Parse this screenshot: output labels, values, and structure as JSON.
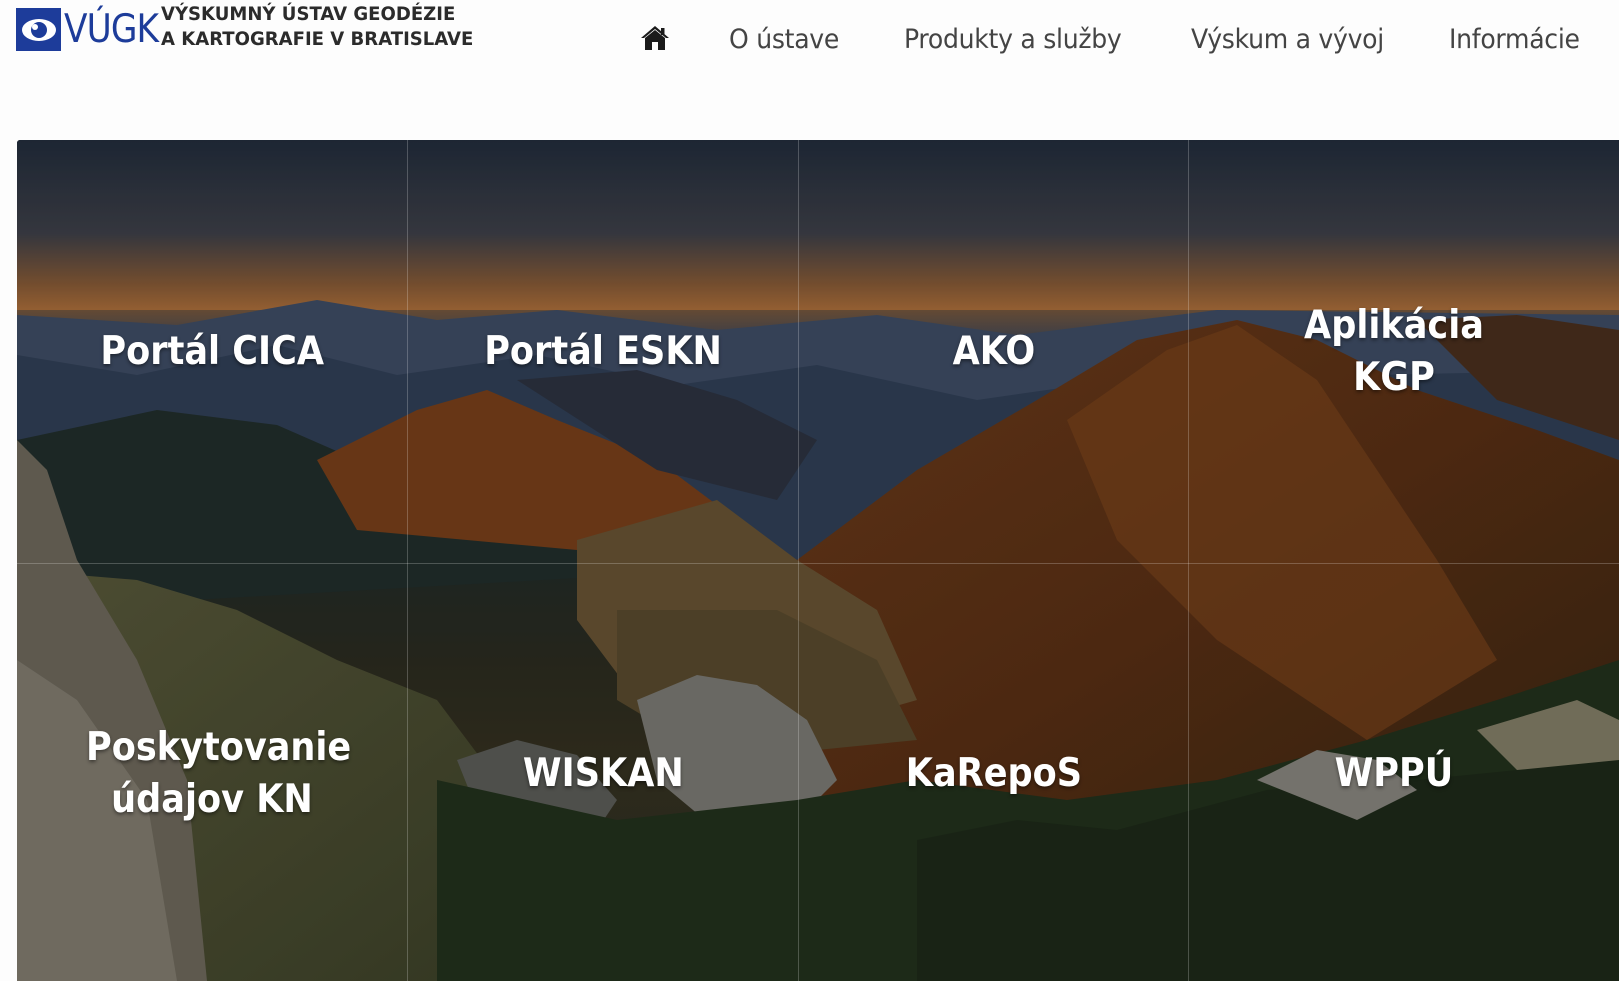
{
  "brand": {
    "abbr": "VÚGK",
    "name_line1": "VÝSKUMNÝ ÚSTAV GEODÉZIE",
    "name_line2": "A KARTOGRAFIE V BRATISLAVE",
    "color": "#1d3c9a"
  },
  "nav": {
    "home_icon": "home-icon",
    "items": [
      {
        "label": "O ústave"
      },
      {
        "label": "Produkty a služby"
      },
      {
        "label": "Výskum a vývoj"
      },
      {
        "label": "Informácie"
      }
    ]
  },
  "tiles": [
    {
      "label": "Portál CICA"
    },
    {
      "label": "Portál ESKN"
    },
    {
      "label": "AKO"
    },
    {
      "label": "Aplikácia KGP"
    },
    {
      "label": "Poskytovanie údajov KN"
    },
    {
      "label": "WISKAN"
    },
    {
      "label": "KaRepoS"
    },
    {
      "label": "WPPÚ"
    }
  ]
}
